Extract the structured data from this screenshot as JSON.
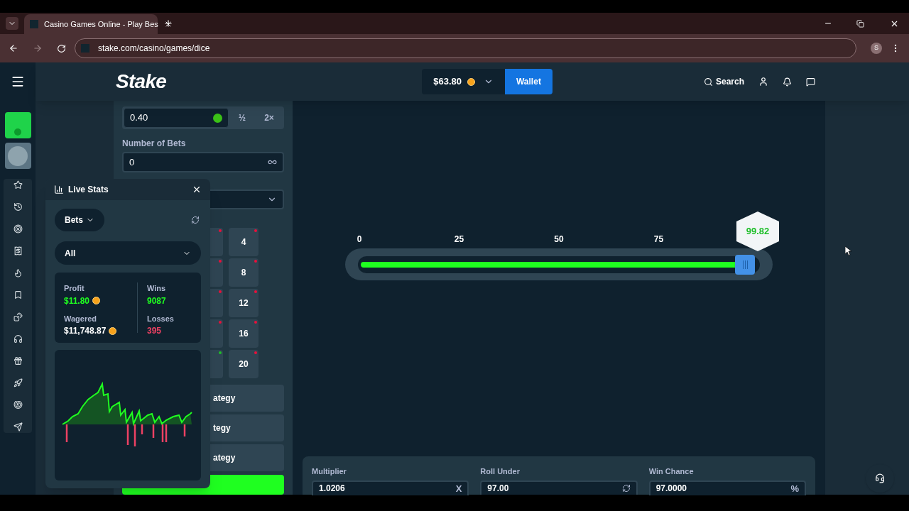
{
  "browser": {
    "tab_title": "Casino Games Online - Play Bes",
    "url": "stake.com/casino/games/dice",
    "profile_initial": "S"
  },
  "header": {
    "logo": "Stake",
    "balance": "$63.80",
    "wallet_button": "Wallet",
    "search": "Search"
  },
  "bet_panel": {
    "bet_amount": "0.40",
    "half_button": "½",
    "double_button": "2×",
    "number_of_bets_label": "Number of Bets",
    "number_of_bets": "0",
    "grid_rows": [
      {
        "cells": [
          {
            "color": "#e9113c"
          },
          {
            "label": "4",
            "color": "#e9113c"
          }
        ]
      },
      {
        "cells": [
          {
            "color": "#e9113c"
          },
          {
            "label": "8",
            "color": "#e9113c"
          }
        ]
      },
      {
        "cells": [
          {
            "color": "#e9113c"
          },
          {
            "label": "12",
            "color": "#e9113c"
          }
        ]
      },
      {
        "cells": [
          {
            "color": "#e9113c"
          },
          {
            "label": "16",
            "color": "#e9113c"
          }
        ]
      },
      {
        "cells": [
          {
            "color": "#1fbf2a"
          },
          {
            "label": "20",
            "color": "#e9113c"
          }
        ]
      }
    ],
    "strategy_buttons": [
      "ategy",
      "tegy",
      "ategy"
    ]
  },
  "live_stats": {
    "title": "Live Stats",
    "bets_dropdown": "Bets",
    "filter": "All",
    "profit_label": "Profit",
    "profit": "$11.80",
    "wins_label": "Wins",
    "wins": "9087",
    "wagered_label": "Wagered",
    "wagered": "$11,748.87",
    "losses_label": "Losses",
    "losses": "395"
  },
  "slider": {
    "ticks": [
      "0",
      "25",
      "50",
      "75"
    ],
    "level": 0.97,
    "result": "99.82"
  },
  "fields": [
    {
      "label": "Multiplier",
      "value": "1.0206",
      "kind": "suffix",
      "suffix": "X"
    },
    {
      "label": "Roll Under",
      "value": "97.00",
      "kind": "refresh"
    },
    {
      "label": "Win Chance",
      "value": "97.0000",
      "kind": "suffix",
      "suffix": "%"
    }
  ]
}
